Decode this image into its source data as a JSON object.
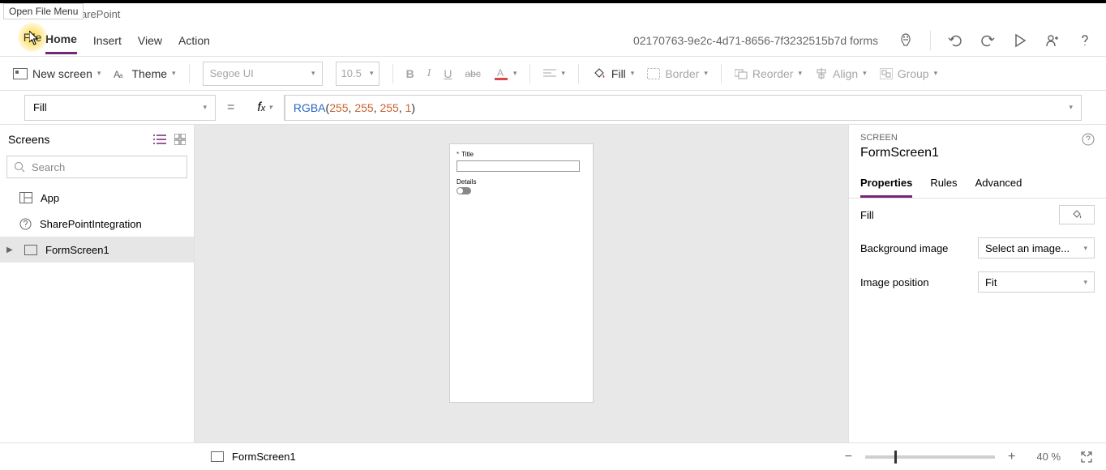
{
  "tooltip": "Open File Menu",
  "header": {
    "breadcrumb": "arePoint"
  },
  "menu": {
    "file": "File",
    "tabs": [
      "Home",
      "Insert",
      "View",
      "Action"
    ],
    "active": "Home",
    "doc_title": "02170763-9e2c-4d71-8656-7f3232515b7d forms"
  },
  "toolbar": {
    "new_screen": "New screen",
    "theme": "Theme",
    "font": "Segoe UI",
    "font_size": "10.5",
    "fill": "Fill",
    "border": "Border",
    "reorder": "Reorder",
    "align": "Align",
    "group": "Group"
  },
  "formula": {
    "property": "Fill",
    "fn": "RGBA",
    "args": [
      "255",
      "255",
      "255",
      "1"
    ]
  },
  "left": {
    "title": "Screens",
    "search_placeholder": "Search",
    "items": [
      {
        "label": "App",
        "icon": "app"
      },
      {
        "label": "SharePointIntegration",
        "icon": "question"
      },
      {
        "label": "FormScreen1",
        "icon": "screen",
        "selected": true,
        "expandable": true
      }
    ]
  },
  "canvas": {
    "field1_label": "Title",
    "field2_label": "Details"
  },
  "right": {
    "type": "SCREEN",
    "name": "FormScreen1",
    "tabs": [
      "Properties",
      "Rules",
      "Advanced"
    ],
    "active": "Properties",
    "props": {
      "fill_label": "Fill",
      "bg_image_label": "Background image",
      "bg_image_value": "Select an image...",
      "img_pos_label": "Image position",
      "img_pos_value": "Fit"
    }
  },
  "status": {
    "screen": "FormScreen1",
    "zoom": "40",
    "zoom_pct": "%"
  }
}
